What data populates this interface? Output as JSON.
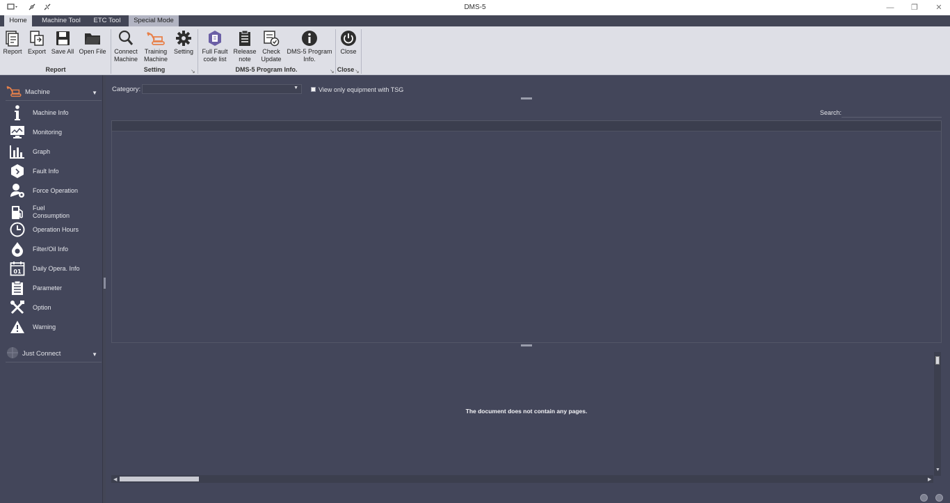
{
  "window": {
    "title": "DMS-5"
  },
  "tabs": [
    {
      "label": "Home"
    },
    {
      "label": "Machine Tool"
    },
    {
      "label": "ETC Tool"
    },
    {
      "label": "Special Mode"
    }
  ],
  "ribbon": {
    "groups": {
      "report": "Report",
      "setting": "Setting",
      "program": "DMS-5 Program Info.",
      "close": "Close"
    },
    "buttons": {
      "report": "Report",
      "export": "Export",
      "save_all": "Save All",
      "open_file": "Open File",
      "connect_l1": "Connect",
      "connect_l2": "Machine",
      "training_l1": "Training",
      "training_l2": "Machine",
      "setting": "Setting",
      "fullfault_l1": "Full Fault",
      "fullfault_l2": "code list",
      "release_l1": "Release",
      "release_l2": "note",
      "check_l1": "Check",
      "check_l2": "Update",
      "proginfo_l1": "DMS-5 Program",
      "proginfo_l2": "Info.",
      "close": "Close"
    }
  },
  "sidebar": {
    "machine_header": "Machine",
    "items": [
      {
        "label": "Machine Info"
      },
      {
        "label": "Monitoring"
      },
      {
        "label": "Graph"
      },
      {
        "label": "Fault Info"
      },
      {
        "label": "Force Operation"
      },
      {
        "label_l1": "Fuel",
        "label_l2": "Consumption"
      },
      {
        "label": "Operation Hours"
      },
      {
        "label": "Filter/Oil Info"
      },
      {
        "label": "Daily Opera. Info"
      },
      {
        "label": "Parameter"
      },
      {
        "label": "Option"
      },
      {
        "label": "Warning"
      }
    ],
    "just_connect_header": "Just Connect"
  },
  "main": {
    "category_label": "Category:",
    "category_value": "",
    "tsg_label": "View only equipment with TSG",
    "search_label": "Search:",
    "search_value": "",
    "viewer_message": "The document does not contain any pages."
  },
  "colors": {
    "background": "#434656",
    "ribbon": "#dedfe6",
    "accent_orange": "#e8814a",
    "accent_purple": "#6b5fa6"
  }
}
